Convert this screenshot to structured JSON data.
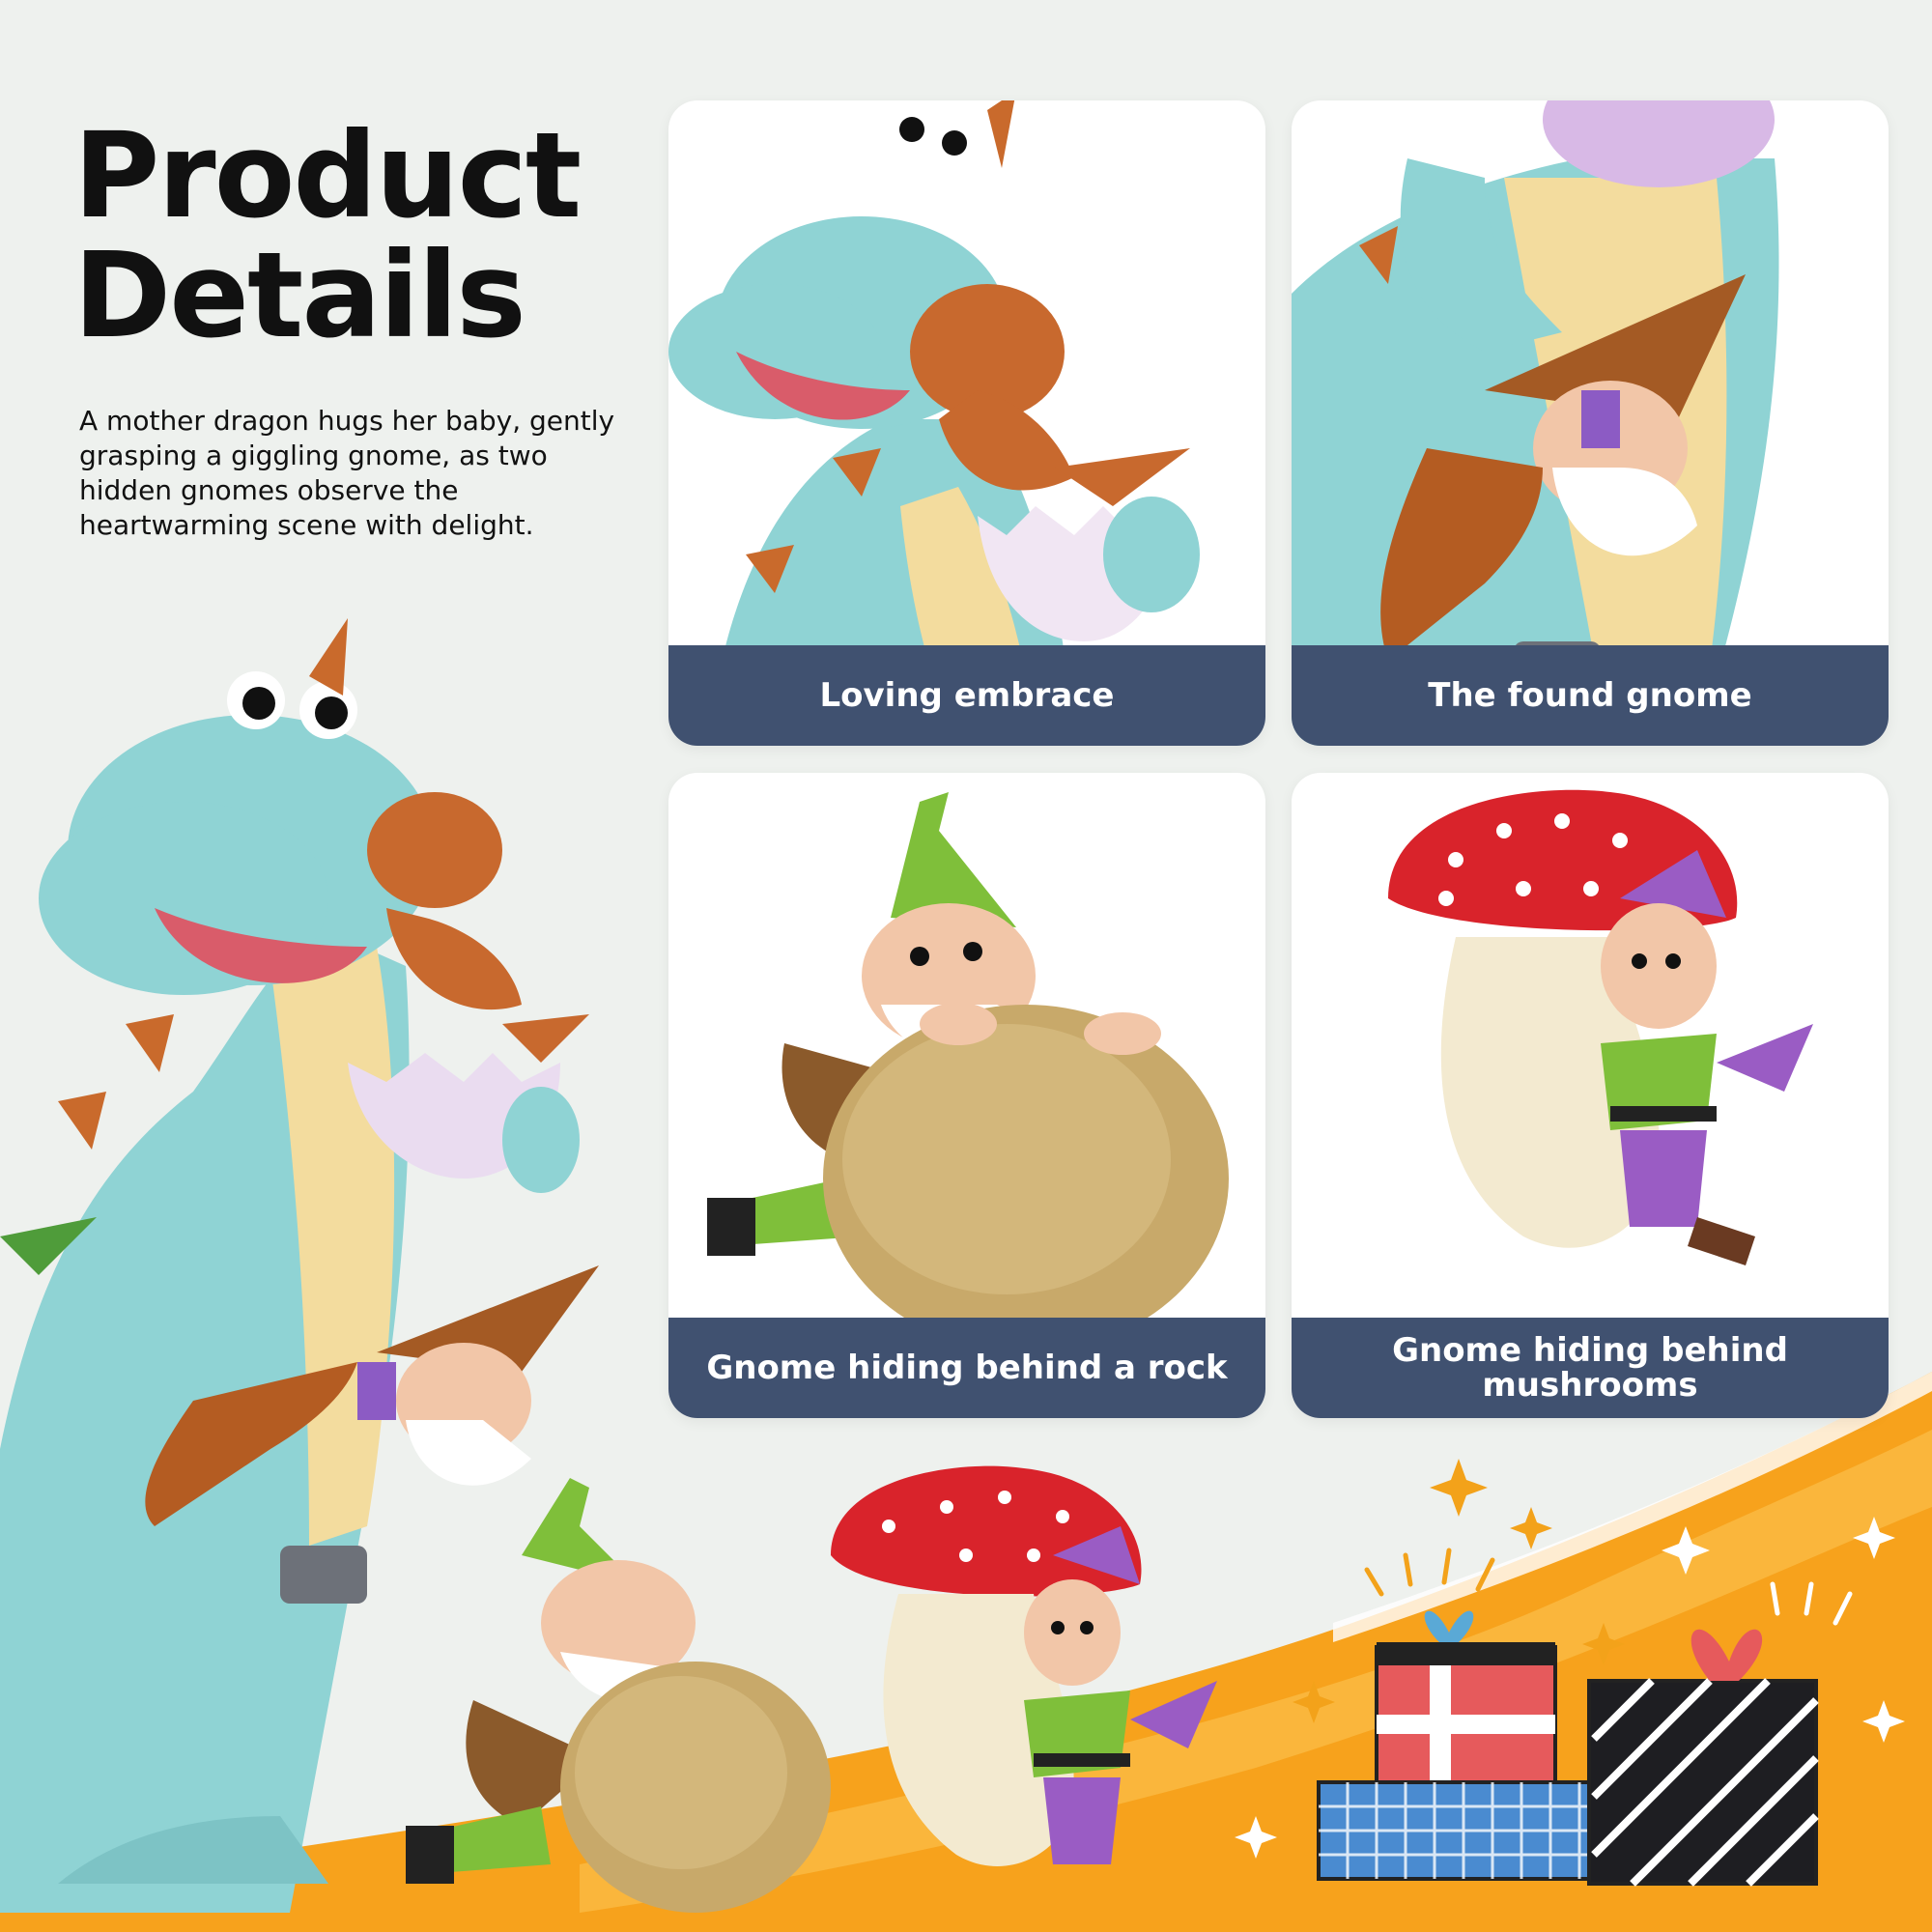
{
  "heading": {
    "line1": "Product",
    "line2": "Details"
  },
  "description": "A mother dragon hugs her baby, gently grasping a giggling gnome, as two hidden gnomes observe the heartwarming scene with delight.",
  "cards": [
    {
      "label": "Loving embrace",
      "image": "dragon-hug-closeup"
    },
    {
      "label": "The found gnome",
      "image": "found-gnome-closeup"
    },
    {
      "label": "Gnome hiding behind a rock",
      "image": "rock-gnome"
    },
    {
      "label": "Gnome hiding behind mushrooms",
      "image": "mushroom-gnome"
    }
  ],
  "colors": {
    "background": "#eef1ee",
    "caption_bar": "#405170",
    "accent_orange": "#f7a21c",
    "dragon_teal": "#8fd3d4",
    "mushroom_red": "#d9232b",
    "gnome_green": "#7fbf3a",
    "gnome_purple": "#9a5cc4"
  }
}
